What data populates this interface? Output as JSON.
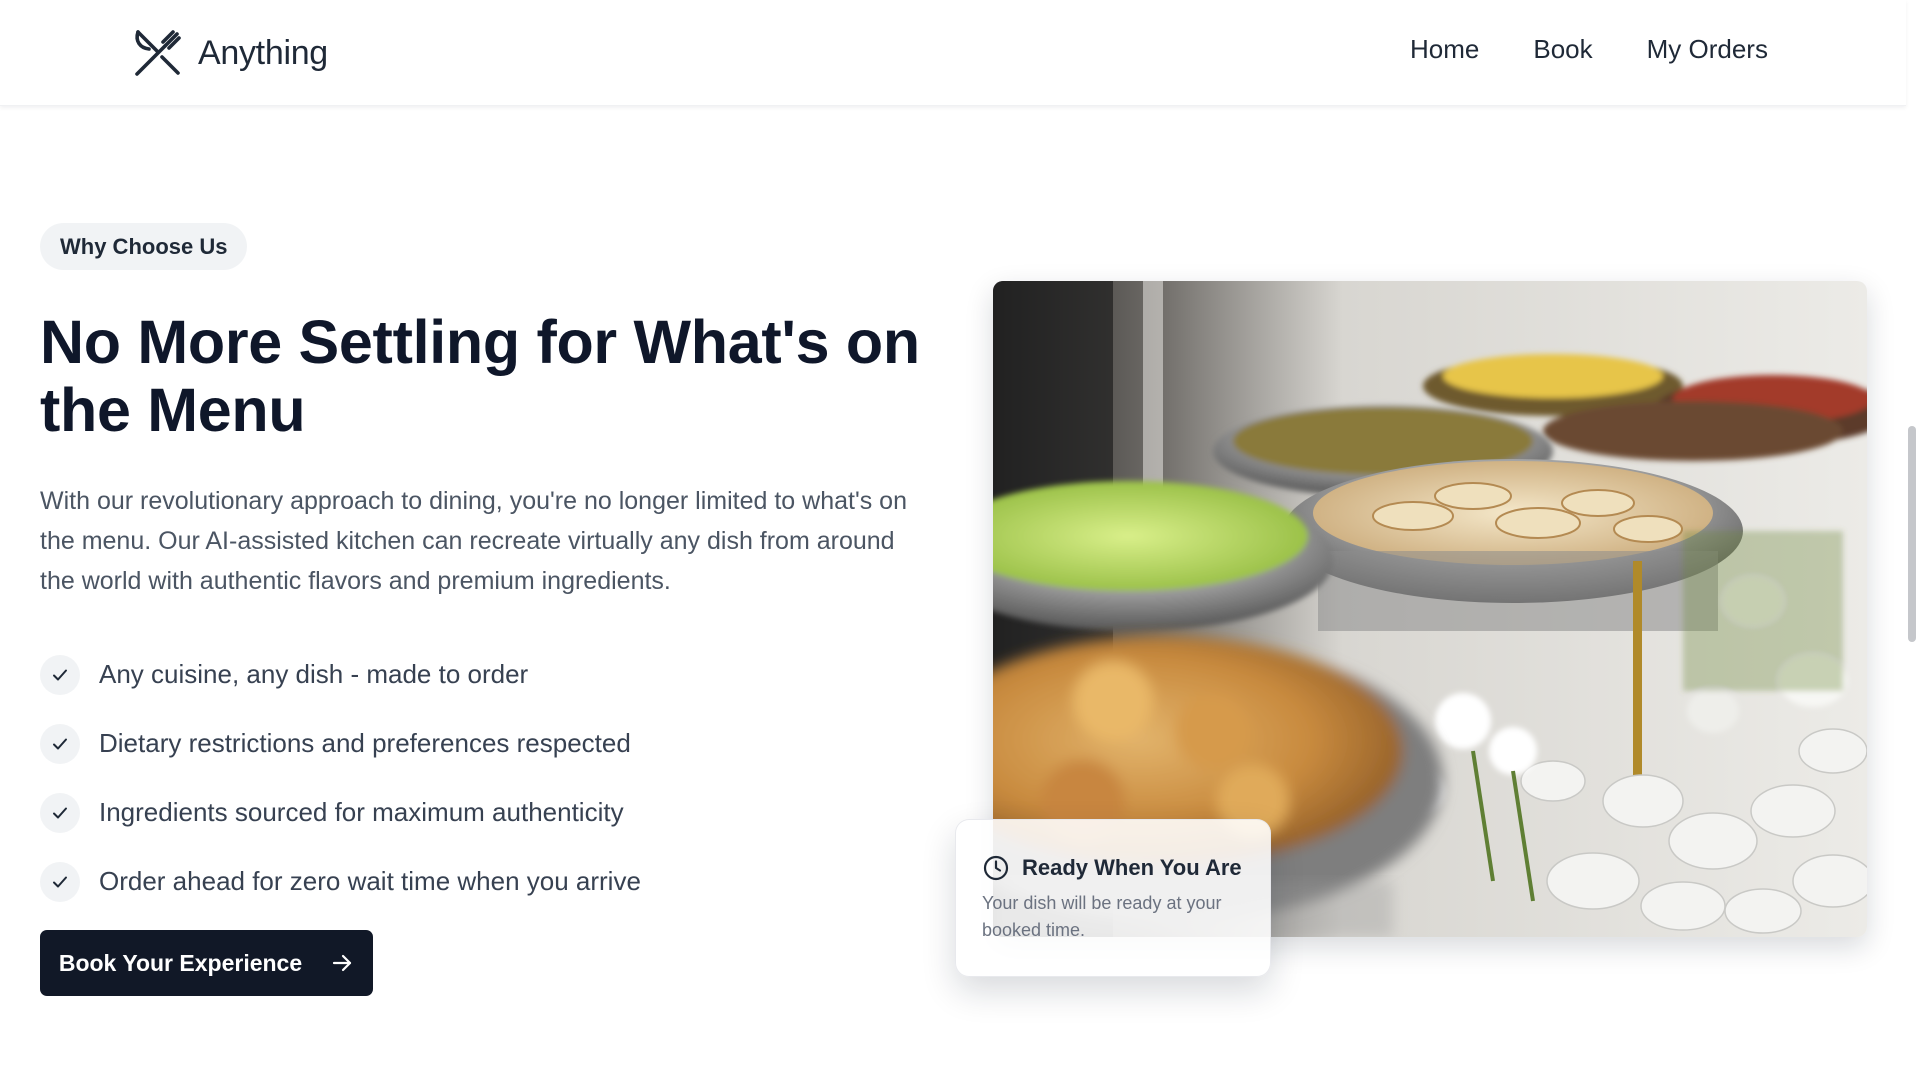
{
  "brand": {
    "name": "Anything",
    "logo_icon": "fork-knife-icon"
  },
  "nav": {
    "links": [
      "Home",
      "Book",
      "My Orders"
    ]
  },
  "hero": {
    "badge": "Why Choose Us",
    "headline": "No More Settling for What's on the Menu",
    "description": "With our revolutionary approach to dining, you're no longer limited to what's on the menu. Our AI-assisted kitchen can recreate virtually any dish from around the world with authentic flavors and premium ingredients.",
    "features": [
      "Any cuisine, any dish - made to order",
      "Dietary restrictions and preferences respected",
      "Ingredients sourced for maximum authenticity",
      "Order ahead for zero wait time when you arrive"
    ],
    "cta_label": "Book Your Experience"
  },
  "info_card": {
    "title": "Ready When You Are",
    "description": "Your dish will be ready at your booked time.",
    "icon": "clock-icon"
  },
  "colors": {
    "primary": "#111827",
    "text_body": "#4b5563",
    "badge_bg": "#f1f3f5"
  }
}
